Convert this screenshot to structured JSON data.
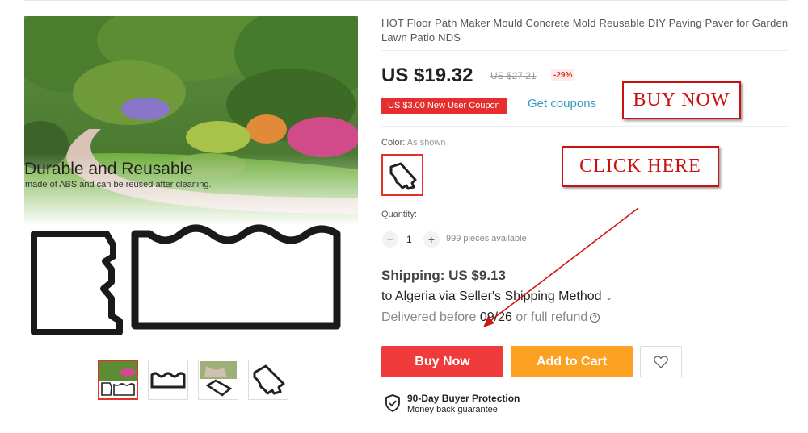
{
  "product": {
    "title": "HOT Floor Path Maker Mould Concrete Mold Reusable DIY Paving Paver for Garden Lawn Patio NDS",
    "price": "US $19.32",
    "original_price": "US $27.21",
    "discount": "-29%",
    "coupon": "US $3.00 New User Coupon",
    "coupon_link": "Get coupons"
  },
  "gallery": {
    "headline": "Durable and Reusable",
    "caption": "made of ABS and can be reused after cleaning.",
    "thumbnails": [
      "thumb-1",
      "thumb-2",
      "thumb-3",
      "thumb-4"
    ],
    "active_thumbnail": 1
  },
  "options": {
    "color_label": "Color:",
    "color_value": "As shown",
    "quantity_label": "Quantity:",
    "quantity": "1",
    "minus": "−",
    "plus": "+",
    "available": "999 pieces available"
  },
  "shipping": {
    "price": "Shipping: US $9.13",
    "method": "to Algeria via Seller's Shipping Method",
    "delivery_prefix": "Delivered before ",
    "delivery_date": "09/26",
    "delivery_suffix": " or full refund",
    "help": "?"
  },
  "actions": {
    "buy_now": "Buy Now",
    "add_to_cart": "Add to Cart"
  },
  "protection": {
    "title": "90-Day Buyer Protection",
    "subtitle": "Money back guarantee"
  },
  "annotations": {
    "buy_now_box": "BUY NOW",
    "click_here_box": "CLICK HERE",
    "color": "#cc1010"
  },
  "colors": {
    "accent_red": "#ef3b3b",
    "cart_orange": "#fca121",
    "coupon_link": "#2e9cc3"
  },
  "icons": {
    "wishlist": "heart-icon",
    "protection": "shield-check-icon",
    "help": "question-circle-icon",
    "dropdown": "chevron-down-icon"
  }
}
